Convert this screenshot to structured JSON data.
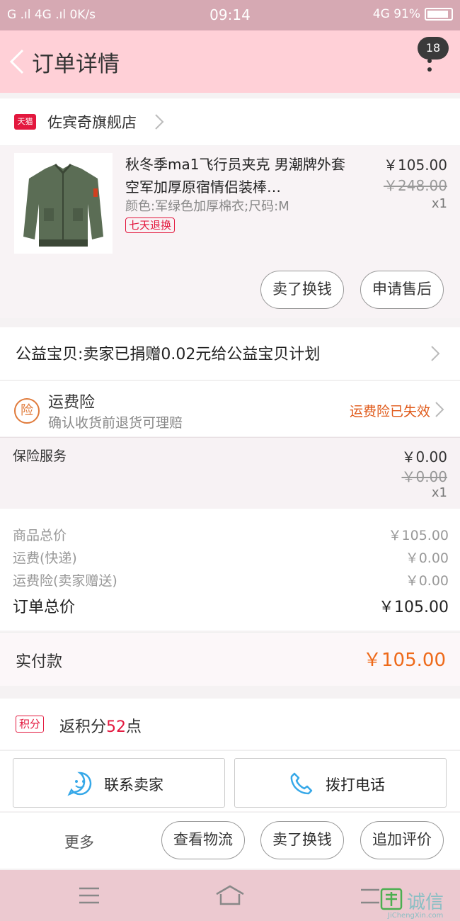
{
  "status_bar": {
    "left": "G .ıl 4G .ıl 0K/s",
    "time": "09:14",
    "right": "4G 91%"
  },
  "header": {
    "title": "订单详情",
    "badge": "18"
  },
  "shop": {
    "name": "佐宾奇旗舰店",
    "tag": "天猫"
  },
  "product": {
    "title": "秋冬季ma1飞行员夹克 男潮牌外套空军加厚原宿情侣装棒…",
    "spec": "颜色:军绿色加厚棉衣;尺码:M",
    "badge": "七天退换",
    "price": "￥105.00",
    "original_price": "￥248.00",
    "quantity": "x1",
    "btn_sell": "卖了换钱",
    "btn_aftersale": "申请售后"
  },
  "charity": {
    "text": "公益宝贝:卖家已捐赠0.02元给公益宝贝计划"
  },
  "freight_insurance": {
    "icon_text": "险",
    "title": "运费险",
    "subtitle": "确认收货前退货可理赔",
    "status": "运费险已失效"
  },
  "insurance_service": {
    "label": "保险服务",
    "price": "￥0.00",
    "original_price": "￥0.00",
    "quantity": "x1"
  },
  "totals": {
    "goods_label": "商品总价",
    "goods_value": "￥105.00",
    "shipping_label": "运费(快递)",
    "shipping_value": "￥0.00",
    "freight_ins_label": "运费险(卖家赠送)",
    "freight_ins_value": "￥0.00",
    "order_label": "订单总价",
    "order_value": "￥105.00"
  },
  "paid": {
    "label": "实付款",
    "value": "￥105.00"
  },
  "points": {
    "badge": "积分",
    "prefix": "返积分",
    "number": "52",
    "suffix": "点"
  },
  "contact": {
    "seller": "联系卖家",
    "call": "拨打电话"
  },
  "actions": {
    "more": "更多",
    "logistics": "查看物流",
    "sell": "卖了换钱",
    "review": "追加评价"
  },
  "watermark": {
    "text": "诚信",
    "url": "JiChengXin.com"
  },
  "colors": {
    "header_bg": "#ffd0d7",
    "status_bg": "#d6a9b3",
    "accent_orange": "#ee6a1a",
    "tmall_red": "#e3183e"
  }
}
